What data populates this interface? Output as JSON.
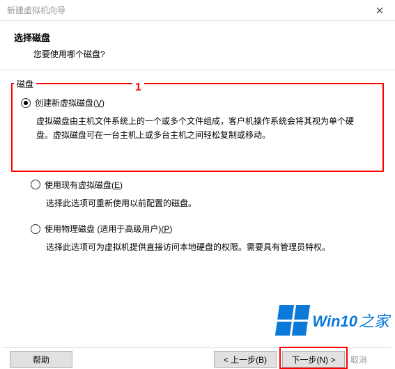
{
  "window": {
    "title": "新建虚拟机向导"
  },
  "header": {
    "title": "选择磁盘",
    "subtitle": "您要使用哪个磁盘?"
  },
  "group": {
    "label": "磁盘",
    "annotation": "1"
  },
  "options": {
    "create": {
      "label_pre": "创建新虚拟磁盘(",
      "label_key": "V",
      "label_post": ")",
      "desc": "虚拟磁盘由主机文件系统上的一个或多个文件组成，客户机操作系统会将其视为单个硬盘。虚拟磁盘可在一台主机上或多台主机之间轻松复制或移动。"
    },
    "existing": {
      "label_pre": "使用现有虚拟磁盘(",
      "label_key": "E",
      "label_post": ")",
      "desc": "选择此选项可重新使用以前配置的磁盘。"
    },
    "physical": {
      "label_pre": "使用物理磁盘 (适用于高级用户)(",
      "label_key": "P",
      "label_post": ")",
      "desc": "选择此选项可为虚拟机提供直接访问本地硬盘的权限。需要具有管理员特权。"
    }
  },
  "footer": {
    "help": "帮助",
    "back": "< 上一步(B)",
    "next": "下一步(N) >",
    "cancel_fragment": "取消"
  },
  "watermark": {
    "brand_a": "Win10",
    "brand_b": "之家"
  }
}
